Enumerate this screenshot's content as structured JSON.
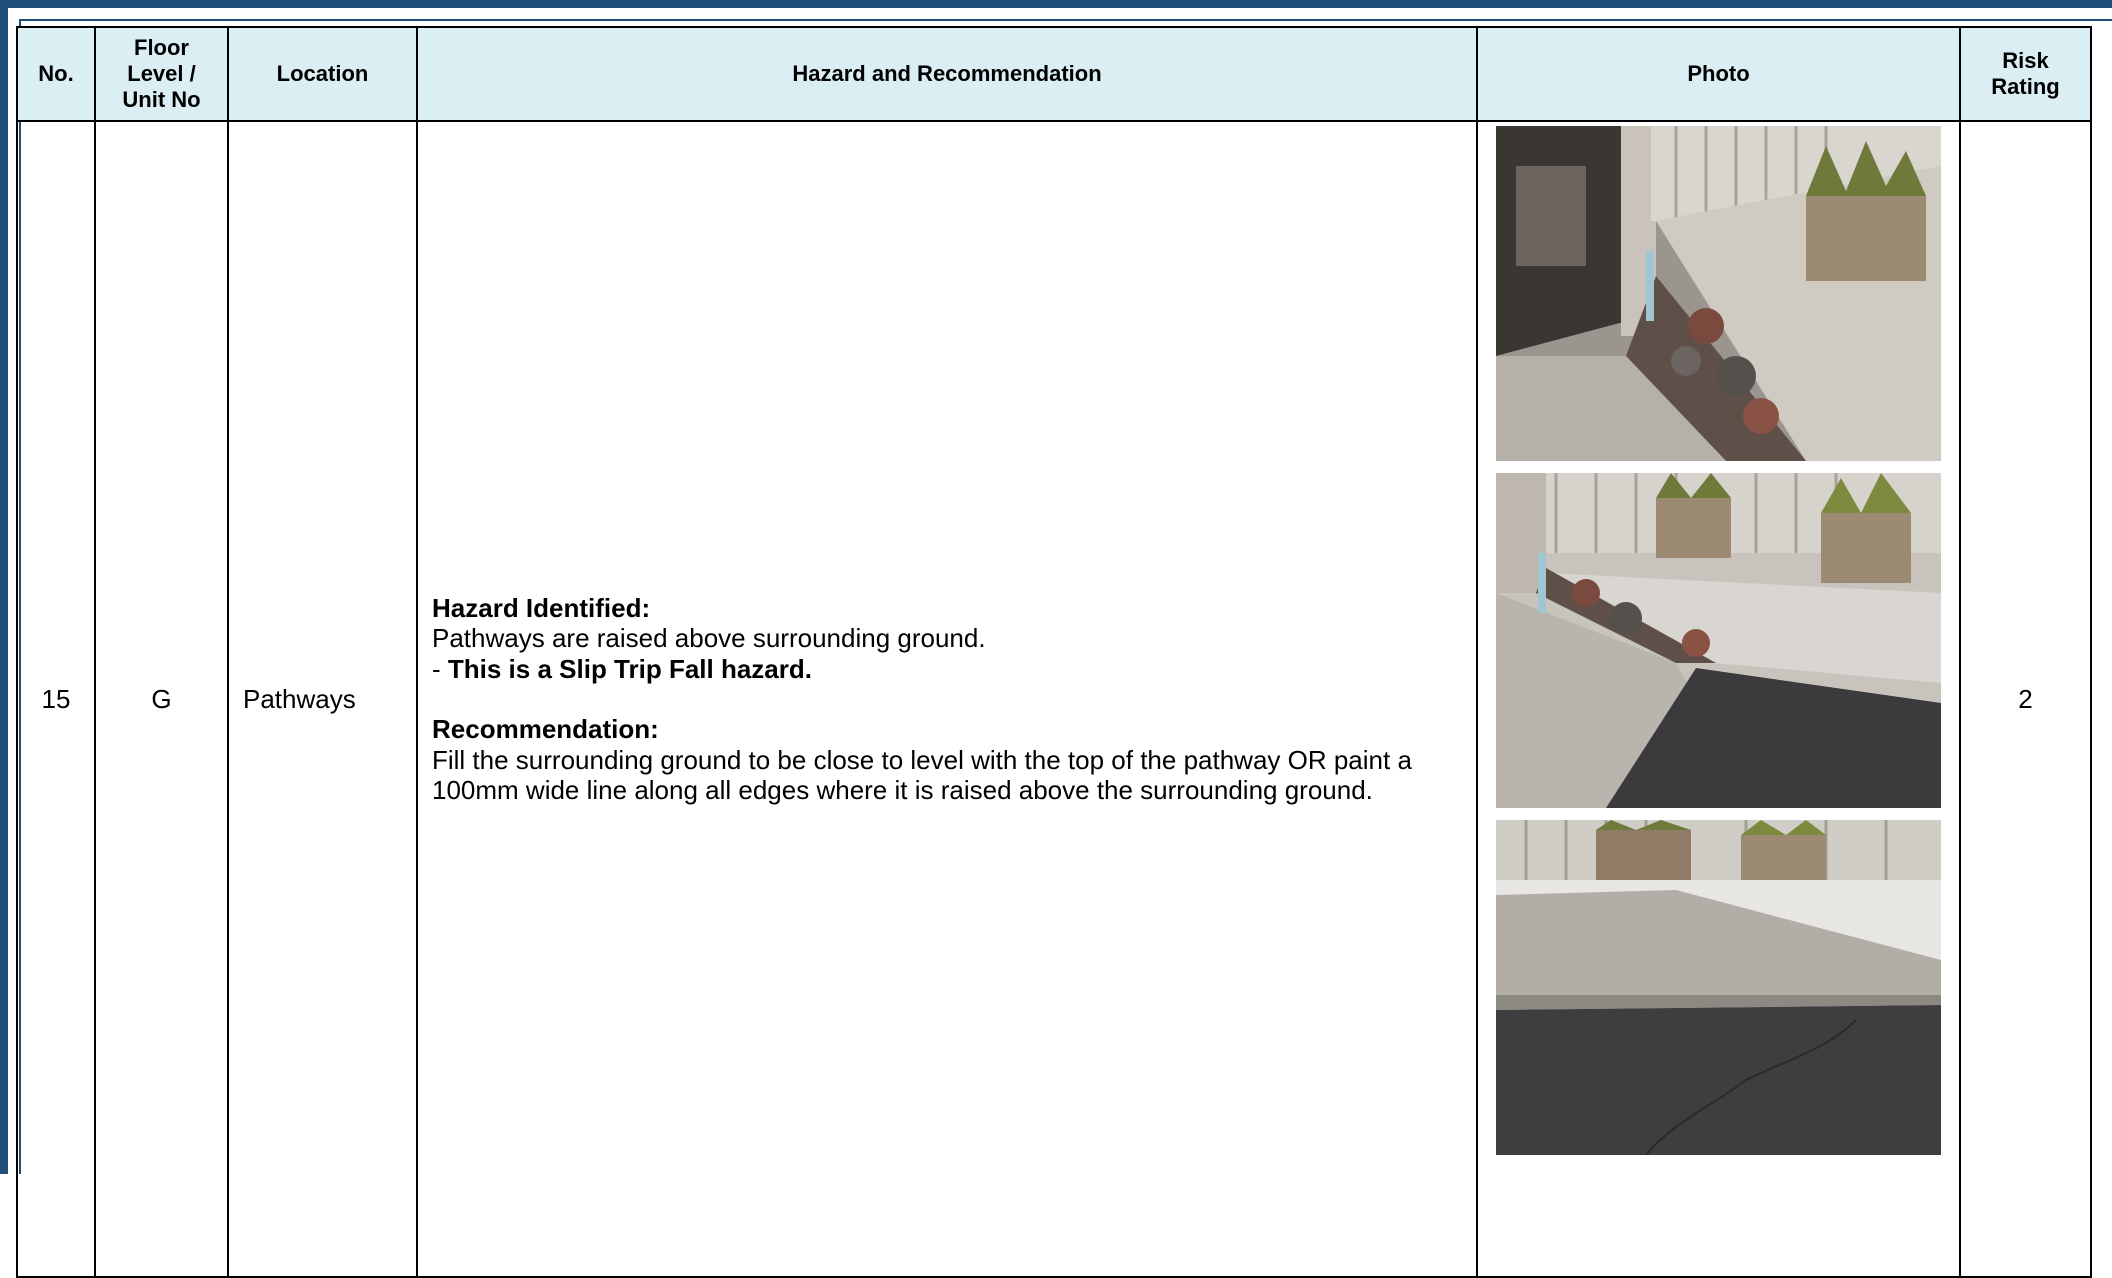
{
  "table": {
    "headers": {
      "no": "No.",
      "floor_line1": "Floor",
      "floor_line2": "Level /",
      "floor_line3": "Unit No",
      "location": "Location",
      "hazard": "Hazard and Recommendation",
      "photo": "Photo",
      "risk_line1": "Risk",
      "risk_line2": "Rating"
    },
    "rows": [
      {
        "no": "15",
        "floor": "G",
        "location": "Pathways",
        "hazard_label": "Hazard Identified:",
        "hazard_text": "Pathways are raised above surrounding ground.",
        "hazard_bullet_prefix": "- ",
        "hazard_bullet_bold": "This is a Slip Trip Fall hazard.",
        "recommendation_label": "Recommendation:",
        "recommendation_text": "Fill the surrounding ground to be close to level with the top of the pathway OR paint a 100mm wide line along all edges where it is raised above the surrounding ground.",
        "risk_rating": "2",
        "photos": [
          {
            "subject": "raised pathway beside stone wall and carport pillar"
          },
          {
            "subject": "raised pathway edge meeting asphalt driveway"
          },
          {
            "subject": "pathway edge step down to asphalt near fence"
          }
        ]
      }
    ]
  },
  "colors": {
    "frame": "#1f4e79",
    "header_bg": "#daeef3",
    "grid": "#000000"
  }
}
